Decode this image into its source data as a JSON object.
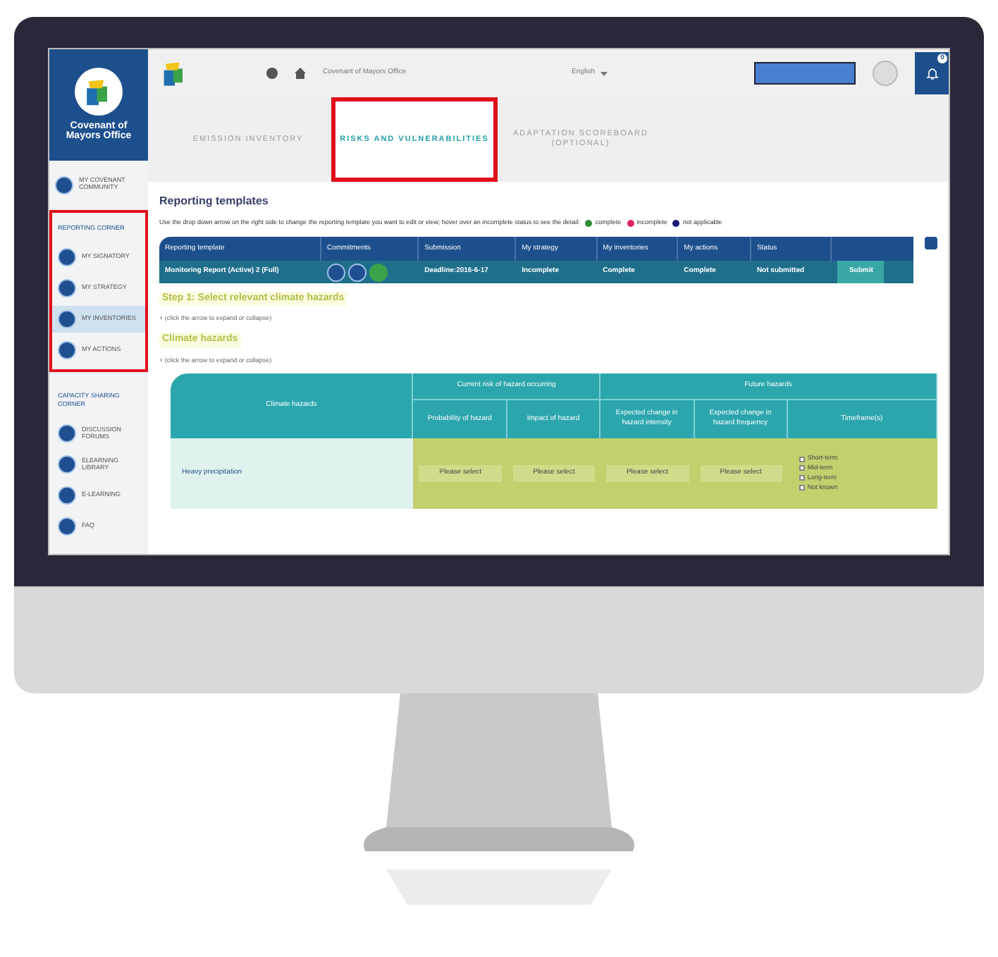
{
  "sidebar": {
    "brand": "Covenant of Mayors Office",
    "top_items": [
      {
        "label": "MY COVENANT COMMUNITY",
        "selected": false
      }
    ],
    "sections": [
      {
        "title": "REPORTING CORNER",
        "highlighted": true,
        "items": [
          {
            "label": "MY SIGNATORY",
            "selected": false
          },
          {
            "label": "MY STRATEGY",
            "selected": false
          },
          {
            "label": "MY INVENTORIES",
            "selected": true
          },
          {
            "label": "MY ACTIONS",
            "selected": false
          }
        ]
      },
      {
        "title": "CAPACITY SHARING CORNER",
        "highlighted": false,
        "items": [
          {
            "label": "DISCUSSION FORUMS",
            "selected": false
          },
          {
            "label": "ELEARNING LIBRARY",
            "selected": false
          },
          {
            "label": "E-LEARNING",
            "selected": false
          },
          {
            "label": "FAQ",
            "selected": false
          }
        ]
      }
    ]
  },
  "topbar": {
    "breadcrumb": "Covenant of Mayors Office",
    "language": "English",
    "notifications": "0"
  },
  "tabs": [
    {
      "label": "EMISSION INVENTORY",
      "selected": false
    },
    {
      "label": "RISKS AND VULNERABILITIES",
      "selected": true
    },
    {
      "label": "ADAPTATION SCOREBOARD (OPTIONAL)",
      "selected": false
    }
  ],
  "reporting": {
    "title": "Reporting templates",
    "instructions": "Use the drop down arrow on the right side to change the reporting template you want to edit or view; hover over an incomplete status to see the detail:",
    "legend": [
      {
        "label": "complete",
        "color": "#2e8b3a"
      },
      {
        "label": "incomplete",
        "color": "#e0245e"
      },
      {
        "label": "not applicable",
        "color": "#1a1a7a"
      }
    ],
    "columns": [
      "Reporting template",
      "Commitments",
      "Submission",
      "My strategy",
      "My inventories",
      "My actions",
      "Status"
    ],
    "row": {
      "template": "Monitoring Report (Active) 2 (Full)",
      "submission": "Deadline:2016-6-17",
      "strategy": "Incomplete",
      "inventories": "Complete",
      "actions": "Complete",
      "status": "Not submitted",
      "button": "Submit"
    }
  },
  "step": {
    "title": "Step 1: Select relevant climate hazards",
    "hint": "+ (click the arrow to expand or collapse)",
    "subtitle": "Climate hazards",
    "subhint": "+ (click the arrow to expand or collapse)"
  },
  "hazards": {
    "first_column": "Climate hazards",
    "groups": [
      {
        "label": "Current risk of hazard occurring",
        "columns": [
          "Probability of hazard",
          "Impact of hazard"
        ]
      },
      {
        "label": "Future hazards",
        "columns": [
          "Expected change in hazard intensity",
          "Expected change in hazard frequency",
          "Timeframe(s)"
        ]
      }
    ],
    "row": {
      "hazard": "Heavy precipitation",
      "selects": [
        "Please select",
        "Please select",
        "Please select",
        "Please select"
      ],
      "timeframes": [
        {
          "label": "Short-term",
          "checked": false
        },
        {
          "label": "Mid-term",
          "checked": false
        },
        {
          "label": "Long-term",
          "checked": false
        },
        {
          "label": "Not known",
          "checked": false
        }
      ]
    }
  }
}
